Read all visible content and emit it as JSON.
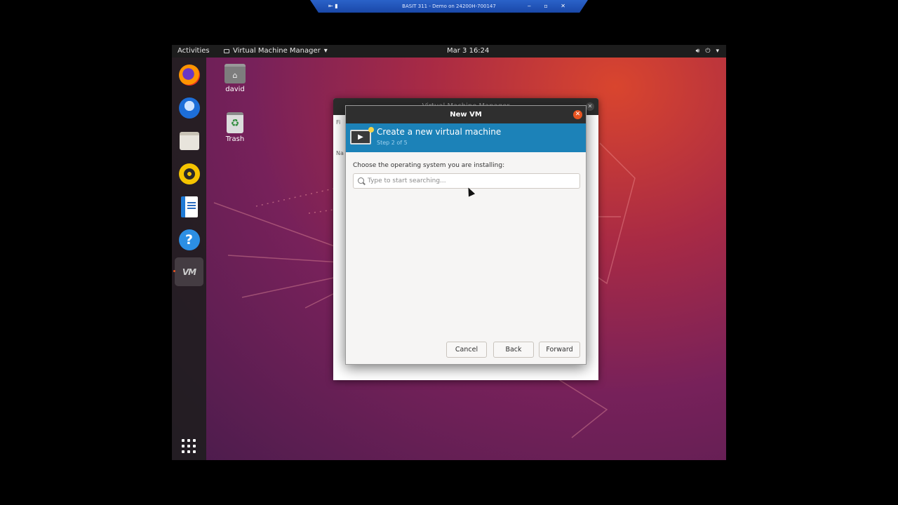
{
  "remote_session": {
    "title": "BASIT 311 - Demo on 24200H-700147"
  },
  "topbar": {
    "activities": "Activities",
    "app_name": "Virtual Machine Manager",
    "clock": "Mar 3  16:24"
  },
  "dock": {
    "items": [
      {
        "name": "firefox"
      },
      {
        "name": "thunderbird"
      },
      {
        "name": "files"
      },
      {
        "name": "rhythmbox"
      },
      {
        "name": "libreoffice-writer"
      },
      {
        "name": "help"
      },
      {
        "name": "virtual-machine-manager",
        "label": "VM",
        "active": true
      }
    ]
  },
  "desktop": {
    "home_label": "david",
    "trash_label": "Trash"
  },
  "back_window": {
    "title": "Virtual Machine Manager",
    "side_labels": [
      "Fi",
      "Na"
    ]
  },
  "dialog": {
    "title": "New VM",
    "header_title": "Create a new virtual machine",
    "header_step": "Step 2 of 5",
    "os_prompt": "Choose the operating system you are installing:",
    "search_placeholder": "Type to start searching...",
    "buttons": {
      "cancel": "Cancel",
      "back": "Back",
      "forward": "Forward"
    }
  },
  "colors": {
    "accent": "#e95420",
    "banner": "#1c82b8",
    "dock": "#1e1e1e"
  }
}
